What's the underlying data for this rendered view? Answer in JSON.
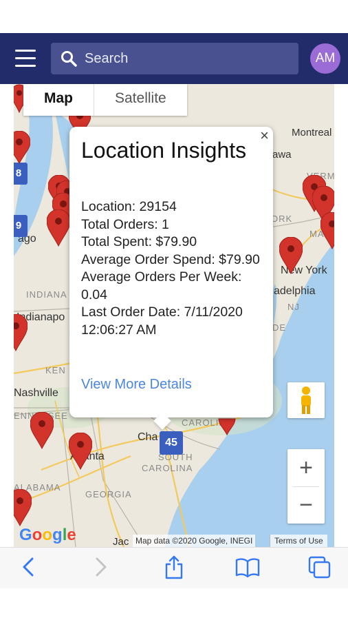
{
  "header": {
    "search_placeholder": "Search",
    "avatar_initials": "AM",
    "colors": {
      "bar": "#232c6b",
      "search_bg": "#4a5191",
      "avatar": "#9c6cd6"
    }
  },
  "map": {
    "toggle": {
      "map_label": "Map",
      "satellite_label": "Satellite",
      "selected": "Map"
    },
    "place_labels": [
      "Montreal",
      "awa",
      "VERM",
      "ORK",
      "MA",
      "New York",
      "adelphia",
      "NJ",
      "DE",
      "INDIANA",
      "Indianapo",
      "KEN",
      "Nashville",
      "ENNESSEE",
      "CAROLIN",
      "Cha",
      "SOUTH",
      "CAROLINA",
      "Atlanta",
      "ALABAMA",
      "GEORGIA",
      "Jac",
      "ago"
    ],
    "route_shields": [
      "8",
      "9",
      "45"
    ],
    "attribution": "Map data ©2020 Google, INEGI",
    "terms_label": "Terms of Use",
    "logo_text": "Google",
    "zoom_in_label": "+",
    "zoom_out_label": "−",
    "marker_color": "#d2332b"
  },
  "popup": {
    "title": "Location Insights",
    "close_label": "×",
    "lines": [
      "Location: 29154",
      "Total Orders: 1",
      "Total Spent: $79.90",
      "Average Order Spend: $79.90",
      "Average Orders Per Week: 0.04",
      "Last Order Date: 7/11/2020 12:06:27 AM"
    ],
    "link": "View More Details"
  },
  "browser_toolbar": {
    "icons": [
      "back-icon",
      "forward-icon",
      "share-icon",
      "bookmarks-icon",
      "tabs-icon"
    ],
    "accent": "#3478f6"
  }
}
